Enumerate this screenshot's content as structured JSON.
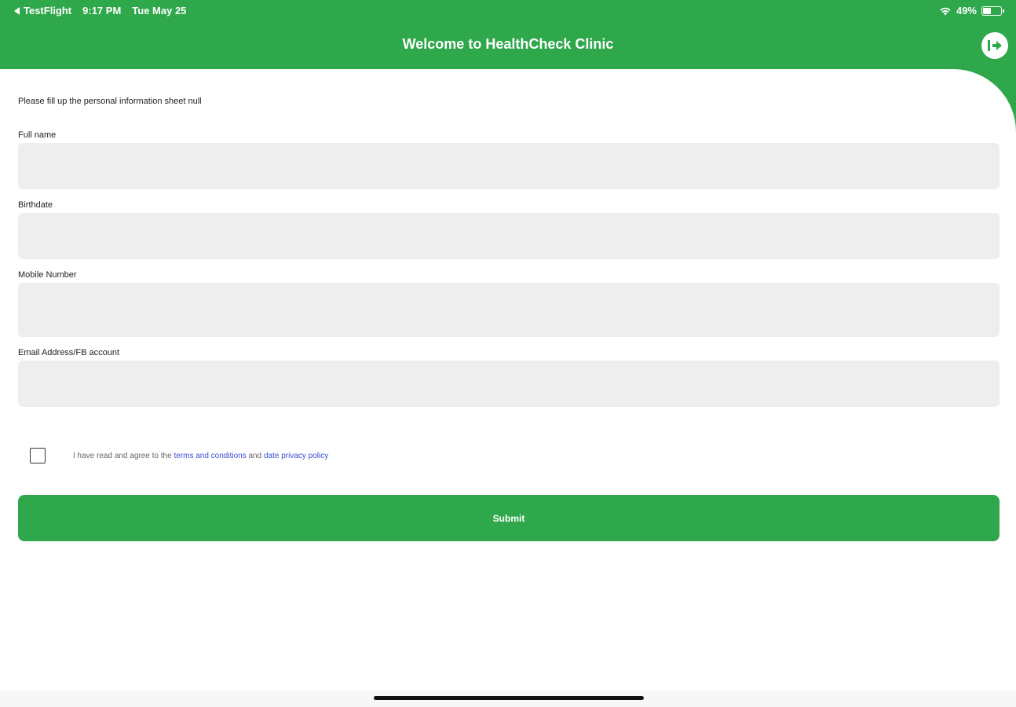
{
  "status_bar": {
    "back_app": "TestFlight",
    "time": "9:17 PM",
    "date": "Tue May 25",
    "battery": "49%",
    "battery_level": 0.49,
    "wifi_icon": "wifi-icon",
    "battery_icon": "battery-icon"
  },
  "header": {
    "title": "Welcome to HealthCheck Clinic",
    "exit_icon": "exit-icon"
  },
  "form": {
    "intro": "Please fill up the personal information sheet null",
    "fields": [
      {
        "label": "Full name",
        "value": "",
        "placeholder": ""
      },
      {
        "label": "Birthdate",
        "value": "",
        "placeholder": ""
      },
      {
        "label": "Mobile Number",
        "value": "",
        "placeholder": ""
      },
      {
        "label": "Email Address/FB account",
        "value": "",
        "placeholder": ""
      }
    ],
    "agreement": {
      "checked": false,
      "text_before": "I have read and agree to the ",
      "terms_link": "terms and conditions",
      "text_middle": " and ",
      "privacy_link": "date privacy policy"
    },
    "submit_label": "Submit"
  },
  "colors": {
    "brand_green": "#2ea84a",
    "link_blue": "#3a4fd1",
    "input_bg": "#eeeeee"
  }
}
